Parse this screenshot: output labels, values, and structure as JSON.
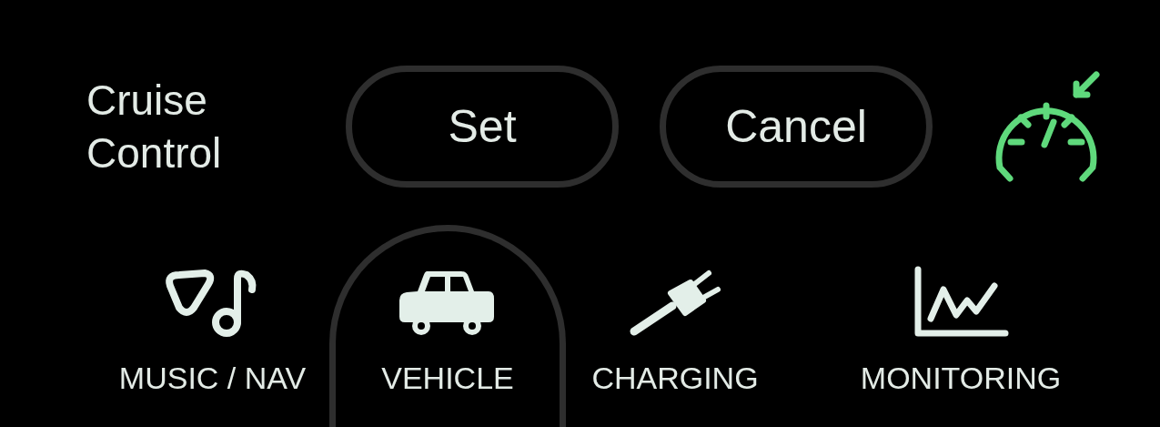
{
  "cruise_control": {
    "title": "Cruise Control",
    "buttons": [
      "Set",
      "Cancel"
    ],
    "indicator_active": true
  },
  "tabs": [
    {
      "kind": "music",
      "label": "MUSIC / NAV",
      "selected": false
    },
    {
      "kind": "vehicle",
      "label": "VEHICLE",
      "selected": true
    },
    {
      "kind": "charging",
      "label": "CHARGING",
      "selected": false
    },
    {
      "kind": "monitoring",
      "label": "MONITORING",
      "selected": false
    }
  ]
}
